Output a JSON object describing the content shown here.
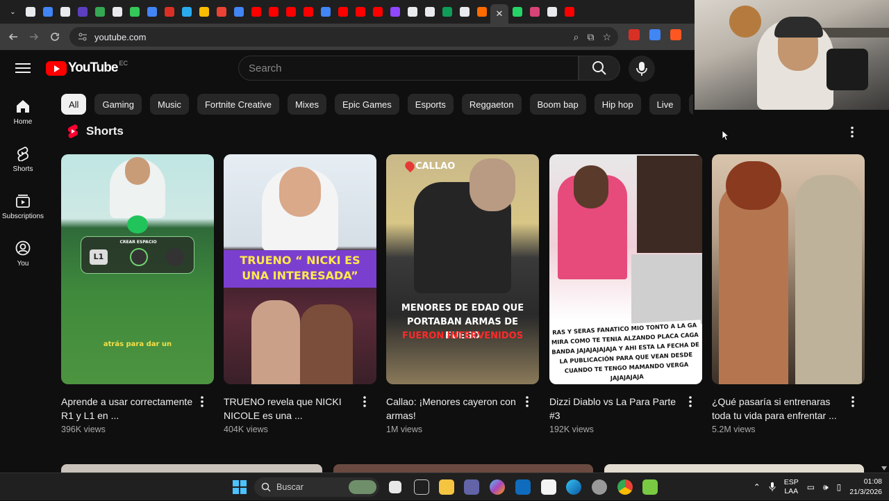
{
  "browser": {
    "url": "youtube.com",
    "tab_favicon_colors": [
      "#e8eaed",
      "#4285f4",
      "#e8eaed",
      "#5b3fbf",
      "#34a853",
      "#e8eaed",
      "#34c759",
      "#4285f4",
      "#d93025",
      "#2aabee",
      "#fbbc04",
      "#ea4335",
      "#4285f4",
      "#ff0000",
      "#ff0000",
      "#ff0000",
      "#ff0000",
      "#4285f4",
      "#ff0000",
      "#ff0000",
      "#ff0000",
      "#9146ff",
      "#e8eaed",
      "#e8eaed",
      "#0f9d58",
      "#e8eaed",
      "#ff6b00",
      "#25d366",
      "#d84378",
      "#e8eaed",
      "#ff0000"
    ],
    "active_tab_close": "✕",
    "extension_colors": [
      "#d93025",
      "#4285f4",
      "#ff5722"
    ]
  },
  "header": {
    "logo_text": "YouTube",
    "country_code": "EC",
    "search_placeholder": "Search"
  },
  "sidebar": {
    "items": [
      {
        "label": "Home",
        "icon": "home-icon"
      },
      {
        "label": "Shorts",
        "icon": "shorts-icon"
      },
      {
        "label": "Subscriptions",
        "icon": "subscriptions-icon"
      },
      {
        "label": "You",
        "icon": "you-icon"
      }
    ]
  },
  "chips": [
    "All",
    "Gaming",
    "Music",
    "Fortnite Creative",
    "Mixes",
    "Epic Games",
    "Esports",
    "Reggaeton",
    "Boom bap",
    "Hip hop",
    "Live",
    "Co"
  ],
  "shorts": {
    "section_title": "Shorts",
    "items": [
      {
        "title": "Aprende a usar correctamente R1 y L1 en ...",
        "views": "396K views",
        "thumb_text": "atrás para dar un",
        "thumb_label": "CREAR ESPACIO",
        "thumb_badge": "L1"
      },
      {
        "title": "TRUENO revela que NICKI NICOLE es una ...",
        "views": "404K views",
        "thumb_text": "TRUENO “ NICKI ES UNA INTERESADA”"
      },
      {
        "title": "Callao: ¡Menores cayeron con armas!",
        "views": "1M views",
        "thumb_text": "MENORES DE EDAD QUE PORTABAN ARMAS DE FUEGO",
        "thumb_text_red": "FUERON INTERVENIDOS",
        "thumb_location": "CALLAO"
      },
      {
        "title": "Dizzi Diablo vs La Para Parte #3",
        "views": "192K views",
        "thumb_text": "RAS Y SERAS FANATICO MIO TONTO A LA GA MIRA COMO TE TENIA ALZANDO PLACA CAGA BANDA JAJAJAJAJAJA Y AHI ESTA LA FECHA DE LA PUBLICACIÓN PARA QUE VEAN DESDE CUANDO TE TENGO MAMANDO VERGA JAJAJAJAJA"
      },
      {
        "title": "¿Qué pasaría si entrenaras toda tu vida para enfrentar ...",
        "views": "5.2M views"
      }
    ]
  },
  "taskbar": {
    "search_placeholder": "Buscar",
    "lang_primary": "ESP",
    "lang_secondary": "LAA",
    "time": "01:08",
    "date": "21/3/2026"
  }
}
